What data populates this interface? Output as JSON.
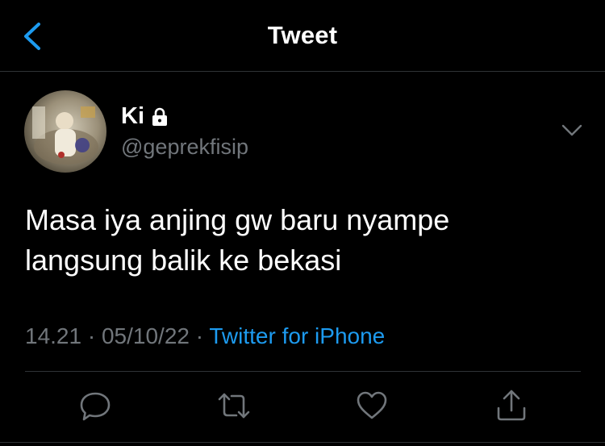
{
  "header": {
    "title": "Tweet",
    "back_icon": "chevron-left-icon"
  },
  "colors": {
    "accent": "#1d9bf0",
    "muted": "#71767b",
    "background": "#000000",
    "divider": "#2f3336"
  },
  "tweet": {
    "author_name": "Ki",
    "author_handle": "@geprekfisip",
    "protected_icon": "lock-icon",
    "text_line1": "Masa iya anjing gw baru nyampe",
    "text_line2": "langsung balik ke bekasi",
    "time": "14.21",
    "date": "05/10/22",
    "separator": "·",
    "source": "Twitter for iPhone"
  },
  "actions": [
    {
      "icon": "reply-icon"
    },
    {
      "icon": "retweet-icon"
    },
    {
      "icon": "like-icon"
    },
    {
      "icon": "share-icon"
    }
  ]
}
